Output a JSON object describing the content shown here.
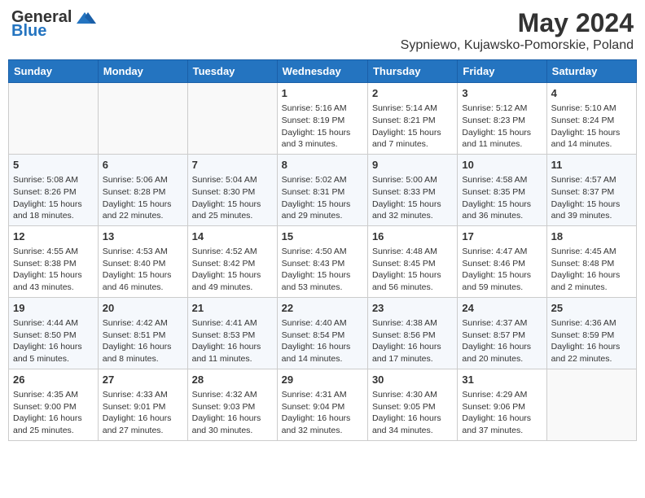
{
  "header": {
    "logo_general": "General",
    "logo_blue": "Blue",
    "month_title": "May 2024",
    "location": "Sypniewo, Kujawsko-Pomorskie, Poland"
  },
  "days_of_week": [
    "Sunday",
    "Monday",
    "Tuesday",
    "Wednesday",
    "Thursday",
    "Friday",
    "Saturday"
  ],
  "weeks": [
    [
      {
        "day": "",
        "info": ""
      },
      {
        "day": "",
        "info": ""
      },
      {
        "day": "",
        "info": ""
      },
      {
        "day": "1",
        "info": "Sunrise: 5:16 AM\nSunset: 8:19 PM\nDaylight: 15 hours\nand 3 minutes."
      },
      {
        "day": "2",
        "info": "Sunrise: 5:14 AM\nSunset: 8:21 PM\nDaylight: 15 hours\nand 7 minutes."
      },
      {
        "day": "3",
        "info": "Sunrise: 5:12 AM\nSunset: 8:23 PM\nDaylight: 15 hours\nand 11 minutes."
      },
      {
        "day": "4",
        "info": "Sunrise: 5:10 AM\nSunset: 8:24 PM\nDaylight: 15 hours\nand 14 minutes."
      }
    ],
    [
      {
        "day": "5",
        "info": "Sunrise: 5:08 AM\nSunset: 8:26 PM\nDaylight: 15 hours\nand 18 minutes."
      },
      {
        "day": "6",
        "info": "Sunrise: 5:06 AM\nSunset: 8:28 PM\nDaylight: 15 hours\nand 22 minutes."
      },
      {
        "day": "7",
        "info": "Sunrise: 5:04 AM\nSunset: 8:30 PM\nDaylight: 15 hours\nand 25 minutes."
      },
      {
        "day": "8",
        "info": "Sunrise: 5:02 AM\nSunset: 8:31 PM\nDaylight: 15 hours\nand 29 minutes."
      },
      {
        "day": "9",
        "info": "Sunrise: 5:00 AM\nSunset: 8:33 PM\nDaylight: 15 hours\nand 32 minutes."
      },
      {
        "day": "10",
        "info": "Sunrise: 4:58 AM\nSunset: 8:35 PM\nDaylight: 15 hours\nand 36 minutes."
      },
      {
        "day": "11",
        "info": "Sunrise: 4:57 AM\nSunset: 8:37 PM\nDaylight: 15 hours\nand 39 minutes."
      }
    ],
    [
      {
        "day": "12",
        "info": "Sunrise: 4:55 AM\nSunset: 8:38 PM\nDaylight: 15 hours\nand 43 minutes."
      },
      {
        "day": "13",
        "info": "Sunrise: 4:53 AM\nSunset: 8:40 PM\nDaylight: 15 hours\nand 46 minutes."
      },
      {
        "day": "14",
        "info": "Sunrise: 4:52 AM\nSunset: 8:42 PM\nDaylight: 15 hours\nand 49 minutes."
      },
      {
        "day": "15",
        "info": "Sunrise: 4:50 AM\nSunset: 8:43 PM\nDaylight: 15 hours\nand 53 minutes."
      },
      {
        "day": "16",
        "info": "Sunrise: 4:48 AM\nSunset: 8:45 PM\nDaylight: 15 hours\nand 56 minutes."
      },
      {
        "day": "17",
        "info": "Sunrise: 4:47 AM\nSunset: 8:46 PM\nDaylight: 15 hours\nand 59 minutes."
      },
      {
        "day": "18",
        "info": "Sunrise: 4:45 AM\nSunset: 8:48 PM\nDaylight: 16 hours\nand 2 minutes."
      }
    ],
    [
      {
        "day": "19",
        "info": "Sunrise: 4:44 AM\nSunset: 8:50 PM\nDaylight: 16 hours\nand 5 minutes."
      },
      {
        "day": "20",
        "info": "Sunrise: 4:42 AM\nSunset: 8:51 PM\nDaylight: 16 hours\nand 8 minutes."
      },
      {
        "day": "21",
        "info": "Sunrise: 4:41 AM\nSunset: 8:53 PM\nDaylight: 16 hours\nand 11 minutes."
      },
      {
        "day": "22",
        "info": "Sunrise: 4:40 AM\nSunset: 8:54 PM\nDaylight: 16 hours\nand 14 minutes."
      },
      {
        "day": "23",
        "info": "Sunrise: 4:38 AM\nSunset: 8:56 PM\nDaylight: 16 hours\nand 17 minutes."
      },
      {
        "day": "24",
        "info": "Sunrise: 4:37 AM\nSunset: 8:57 PM\nDaylight: 16 hours\nand 20 minutes."
      },
      {
        "day": "25",
        "info": "Sunrise: 4:36 AM\nSunset: 8:59 PM\nDaylight: 16 hours\nand 22 minutes."
      }
    ],
    [
      {
        "day": "26",
        "info": "Sunrise: 4:35 AM\nSunset: 9:00 PM\nDaylight: 16 hours\nand 25 minutes."
      },
      {
        "day": "27",
        "info": "Sunrise: 4:33 AM\nSunset: 9:01 PM\nDaylight: 16 hours\nand 27 minutes."
      },
      {
        "day": "28",
        "info": "Sunrise: 4:32 AM\nSunset: 9:03 PM\nDaylight: 16 hours\nand 30 minutes."
      },
      {
        "day": "29",
        "info": "Sunrise: 4:31 AM\nSunset: 9:04 PM\nDaylight: 16 hours\nand 32 minutes."
      },
      {
        "day": "30",
        "info": "Sunrise: 4:30 AM\nSunset: 9:05 PM\nDaylight: 16 hours\nand 34 minutes."
      },
      {
        "day": "31",
        "info": "Sunrise: 4:29 AM\nSunset: 9:06 PM\nDaylight: 16 hours\nand 37 minutes."
      },
      {
        "day": "",
        "info": ""
      }
    ]
  ]
}
